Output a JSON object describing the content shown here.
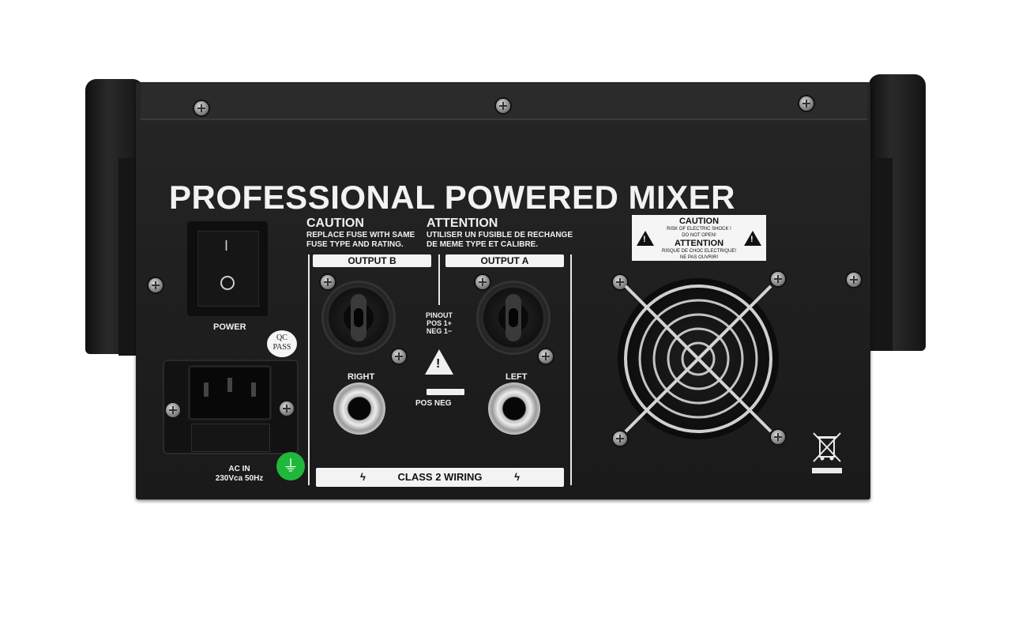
{
  "panel_title": "PROFESSIONAL POWERED MIXER",
  "power": {
    "on_symbol": "I",
    "off_symbol": "O",
    "label": "POWER"
  },
  "qc_sticker": {
    "line1": "QC",
    "line2": "PASS"
  },
  "ac_in": {
    "line1": "AC IN",
    "line2": "230Vca  50Hz"
  },
  "caution_en": {
    "heading": "CAUTION",
    "line1": "REPLACE FUSE WITH SAME",
    "line2": "FUSE TYPE AND RATING."
  },
  "caution_fr": {
    "heading": "ATTENTION",
    "line1": "UTILISER UN FUSIBLE DE RECHANGE",
    "line2": "DE MEME TYPE ET CALIBRE."
  },
  "outputs": {
    "b_label": "OUTPUT B",
    "a_label": "OUTPUT A",
    "right_label": "RIGHT",
    "left_label": "LEFT",
    "pinout": {
      "line1": "PINOUT",
      "line2": "POS  1+",
      "line3": "NEG  1−"
    },
    "pos_neg": "POS NEG",
    "warning_symbol": "!"
  },
  "wiring_label": "CLASS 2 WIRING",
  "bolt_symbol": "ϟ",
  "shock_sticker": {
    "heading_en": "CAUTION",
    "line1_en": "RISK OF ELECTRIC SHOCK !",
    "line2_en": "DO NOT OPEN!",
    "heading_fr": "ATTENTION",
    "line1_fr": "RISQUE DE CHOC ELECTRIQUE!",
    "line2_fr": "NE PAS OUVRIR!",
    "warning_symbol": "!"
  },
  "ground_symbol": "⏚"
}
